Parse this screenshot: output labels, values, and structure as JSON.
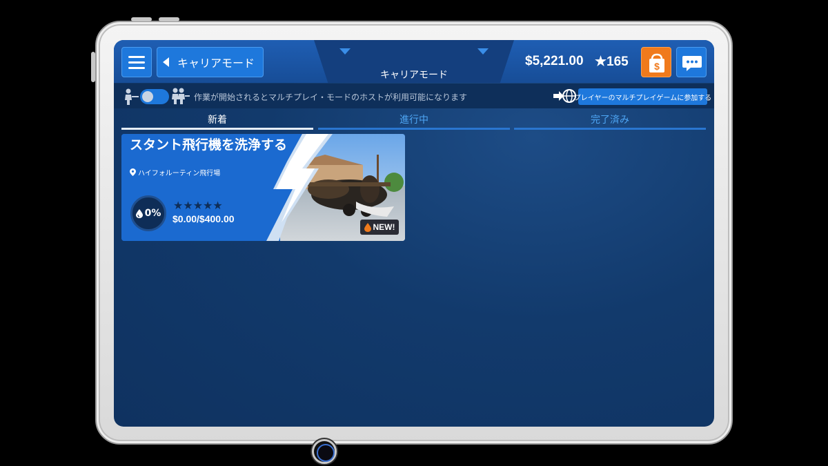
{
  "header": {
    "back_label": "キャリアモード",
    "title": "キャリアモード",
    "money": "$5,221.00",
    "stars": "★165"
  },
  "multiplayer": {
    "notice": "作業が開始されるとマルチプレイ・モードのホストが利用可能になります",
    "join_label": "プレイヤーのマルチプレイゲームに参加する",
    "toggle_on": false
  },
  "tabs": [
    {
      "label": "新着",
      "active": true
    },
    {
      "label": "進行中",
      "active": false
    },
    {
      "label": "完了済み",
      "active": false
    }
  ],
  "jobs": [
    {
      "title": "スタント飛行機を洗浄する",
      "location": "ハイフォルーティン飛行場",
      "progress": "0%",
      "progress_value": 0,
      "rating_stars": "★★★★★",
      "rating_value": 0,
      "pay": "$0.00/$400.00",
      "badge": "NEW!"
    }
  ],
  "colors": {
    "accent": "#1e78dc",
    "shop": "#f07a1c",
    "screen_bg": "#123a6c",
    "tab_inactive": "#4ea6f5"
  },
  "icons": {
    "menu": "hamburger-icon",
    "back": "caret-left-icon",
    "shop": "shopping-bag-icon",
    "chat": "chat-bubble-icon",
    "join": "globe-join-icon",
    "location": "map-pin-icon",
    "water": "water-drop-icon",
    "players": "people-icon"
  }
}
